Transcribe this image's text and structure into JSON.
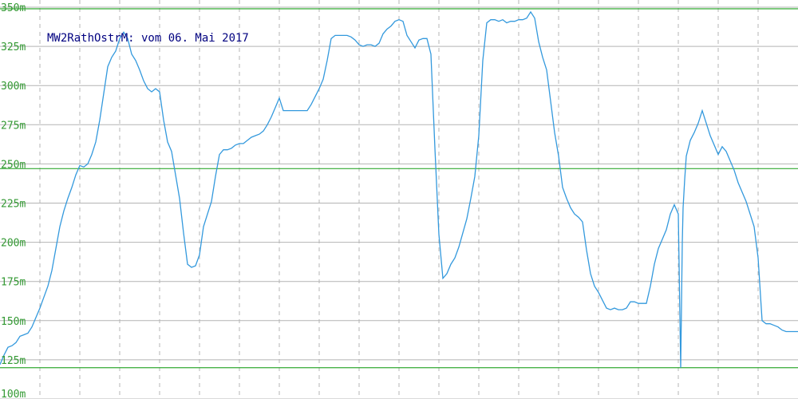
{
  "chart_data": {
    "type": "line",
    "title": "MW2RathOstrM: vom 06. Mai 2017",
    "xlabel": "",
    "ylabel": "",
    "ylim": [
      100,
      350
    ],
    "y_ticks": [
      100,
      125,
      150,
      175,
      200,
      225,
      250,
      275,
      300,
      325,
      350
    ],
    "y_tick_labels": [
      "100m",
      "125m",
      "150m",
      "175m",
      "200m",
      "225m",
      "250m",
      "275m",
      "300m",
      "325m",
      "350m"
    ],
    "x_gridlines": 19,
    "grid": true,
    "reference_lines": [
      349,
      247,
      120
    ],
    "colors": {
      "line": "#3399dd",
      "grid": "#b4b4b4",
      "reference": "#33aa33",
      "tick_text": "#339933",
      "title_text": "#000080"
    },
    "x": [
      0,
      5,
      10,
      15,
      20,
      25,
      30,
      35,
      40,
      45,
      50,
      55,
      60,
      65,
      70,
      75,
      80,
      85,
      90,
      95,
      100,
      105,
      110,
      115,
      120,
      125,
      130,
      135,
      140,
      145,
      150,
      155,
      160,
      165,
      170,
      175,
      180,
      185,
      190,
      195,
      200,
      205,
      210,
      215,
      220,
      225,
      230,
      235,
      240,
      245,
      250,
      255,
      260,
      265,
      270,
      275,
      280,
      285,
      290,
      295,
      300,
      305,
      310,
      315,
      320,
      325,
      330,
      335,
      340,
      345,
      350,
      355,
      360,
      365,
      370,
      375,
      380,
      385,
      390,
      395,
      400,
      405,
      410,
      415,
      420,
      425,
      430,
      435,
      440,
      445,
      450,
      455,
      460,
      465,
      470,
      475,
      480,
      485,
      490,
      495,
      500,
      505,
      510,
      515,
      520,
      525,
      530,
      535,
      540,
      545,
      550,
      555,
      560,
      565,
      570,
      575,
      580,
      585,
      590,
      595,
      600,
      605,
      610,
      615,
      620,
      625,
      630,
      635,
      640,
      645,
      650,
      655,
      660,
      665,
      670,
      675,
      680,
      685,
      690,
      695,
      700,
      705,
      710,
      715,
      720,
      725,
      730,
      735,
      740,
      745,
      750,
      755,
      760,
      765,
      770,
      775,
      780,
      785,
      790,
      795,
      800,
      805,
      810,
      815,
      820,
      825,
      830,
      835,
      840,
      845,
      850,
      853,
      855,
      856,
      858,
      860,
      865,
      870,
      875,
      880,
      885,
      890,
      895,
      900,
      905,
      910,
      915,
      920,
      925,
      930,
      935,
      940,
      945,
      950,
      955,
      960,
      965,
      970,
      975,
      980,
      985,
      990,
      995,
      1000
    ],
    "values": [
      122,
      128,
      133,
      134,
      136,
      140,
      141,
      142,
      146,
      152,
      158,
      165,
      172,
      182,
      196,
      210,
      220,
      228,
      235,
      243,
      249,
      248,
      250,
      256,
      264,
      278,
      295,
      312,
      318,
      322,
      330,
      334,
      330,
      320,
      316,
      310,
      303,
      298,
      296,
      298,
      296,
      278,
      264,
      258,
      243,
      228,
      206,
      186,
      184,
      185,
      192,
      210,
      218,
      226,
      242,
      256,
      259,
      259,
      260,
      262,
      263,
      263,
      265,
      267,
      268,
      269,
      271,
      275,
      280,
      286,
      292,
      284,
      284,
      284,
      284,
      284,
      284,
      284,
      288,
      293,
      298,
      304,
      316,
      330,
      332,
      332,
      332,
      332,
      331,
      329,
      326,
      325,
      326,
      326,
      325,
      327,
      333,
      336,
      338,
      341,
      342,
      341,
      332,
      328,
      324,
      329,
      330,
      330,
      320,
      260,
      205,
      177,
      180,
      186,
      190,
      197,
      206,
      215,
      228,
      242,
      268,
      316,
      340,
      342,
      342,
      341,
      342,
      340,
      341,
      341,
      342,
      342,
      343,
      347,
      343,
      328,
      318,
      310,
      290,
      270,
      255,
      235,
      228,
      222,
      218,
      216,
      213,
      195,
      180,
      172,
      168,
      163,
      158,
      157,
      158,
      157,
      157,
      158,
      162,
      162,
      161,
      161,
      161,
      172,
      186,
      196,
      202,
      208,
      218,
      224,
      218,
      120,
      200,
      222,
      240,
      255,
      265,
      270,
      276,
      284,
      276,
      268,
      262,
      256,
      261,
      258,
      252,
      246,
      238,
      232,
      226,
      218,
      210,
      190,
      150,
      148,
      148,
      147,
      146,
      144,
      143,
      143,
      143,
      143
    ]
  }
}
